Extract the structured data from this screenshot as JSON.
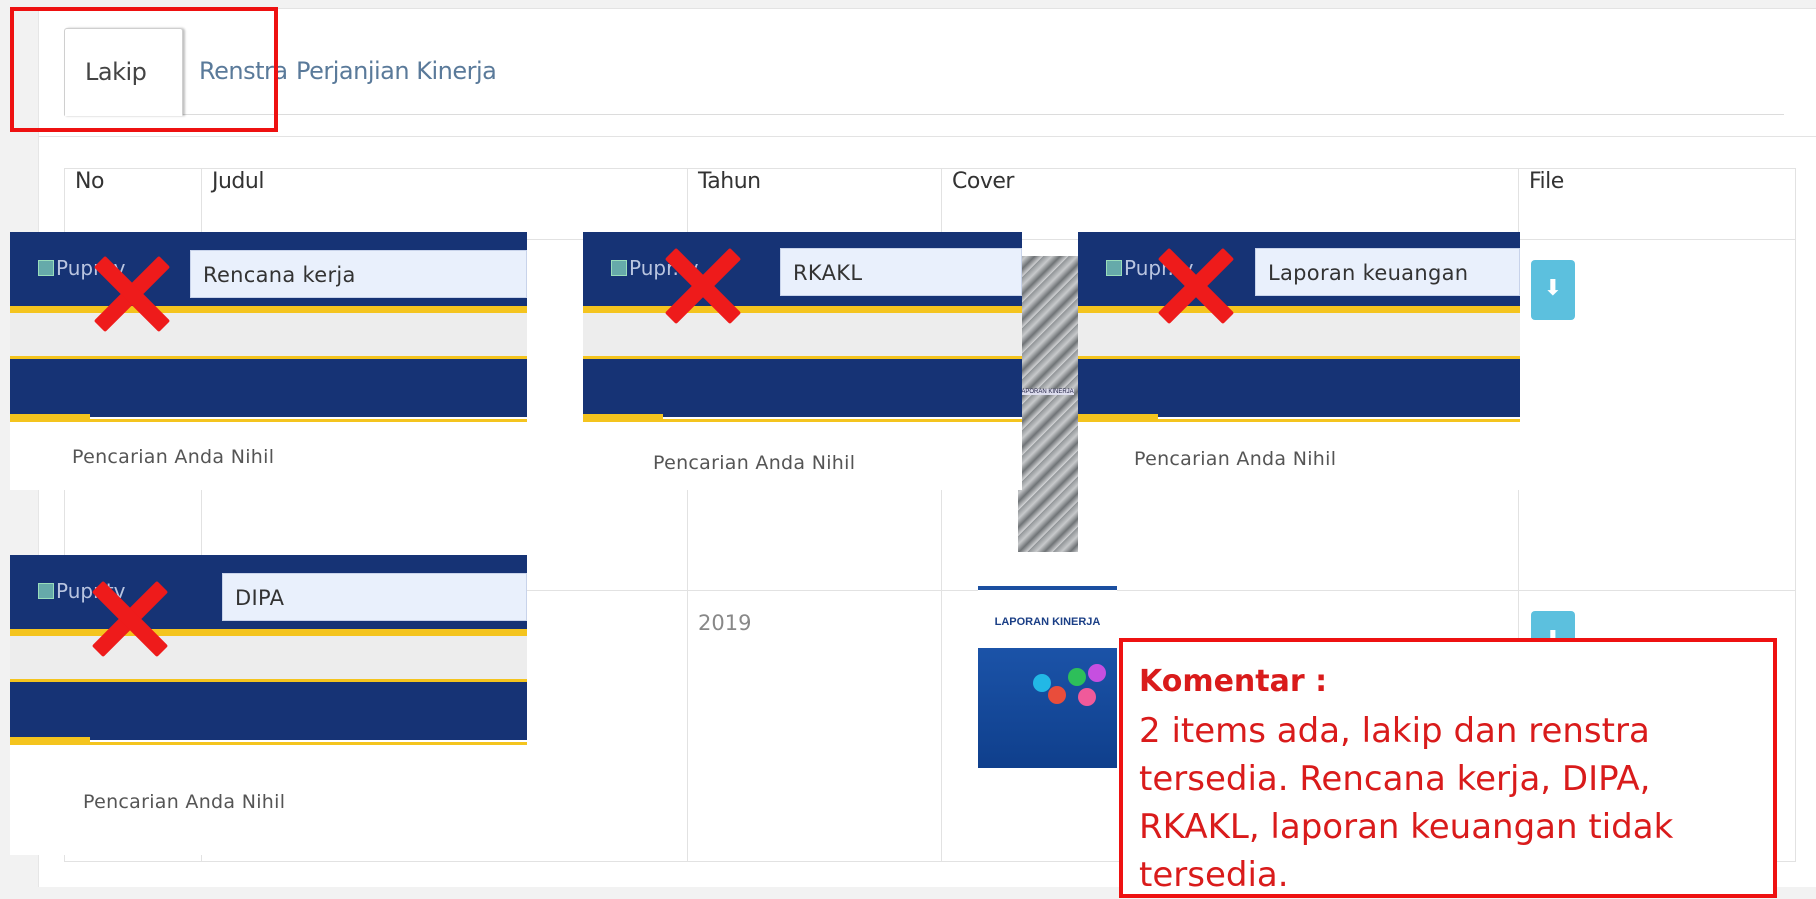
{
  "tabs": [
    {
      "label": "Lakip",
      "active": true
    },
    {
      "label": "Renstra",
      "active": false
    },
    {
      "label": "Perjanjian Kinerja",
      "active": false
    }
  ],
  "table": {
    "headers": [
      "No",
      "Judul",
      "Tahun",
      "Cover",
      "File"
    ],
    "rows": [
      {
        "year": "",
        "file_icon": "download-icon"
      },
      {
        "year": "2019",
        "cover_title": "LAPORAN KINERJA",
        "file_icon": "download-icon"
      }
    ]
  },
  "overlays": [
    {
      "logo": "Pupr.tv",
      "search": "Rencana kerja",
      "message": "Pencarian Anda Nihil"
    },
    {
      "logo": "Pupr.tv",
      "search": "RKAKL",
      "message": "Pencarian Anda Nihil"
    },
    {
      "logo": "Pupr.tv",
      "search": "Laporan keuangan",
      "message": "Pencarian Anda Nihil"
    },
    {
      "logo": "Pupr.tv",
      "search": "DIPA",
      "message": "Pencarian Anda Nihil"
    }
  ],
  "cover1_label": "LAPORAN KINERJA",
  "comment": {
    "title": "Komentar :",
    "body": "2 items ada, lakip dan renstra tersedia. Rencana kerja, DIPA, RKAKL, laporan keuangan tidak tersedia."
  },
  "colors": {
    "accent_red": "#ee1111",
    "nav_blue": "#163375",
    "yellow": "#f4c41e",
    "button": "#5cc0de"
  }
}
